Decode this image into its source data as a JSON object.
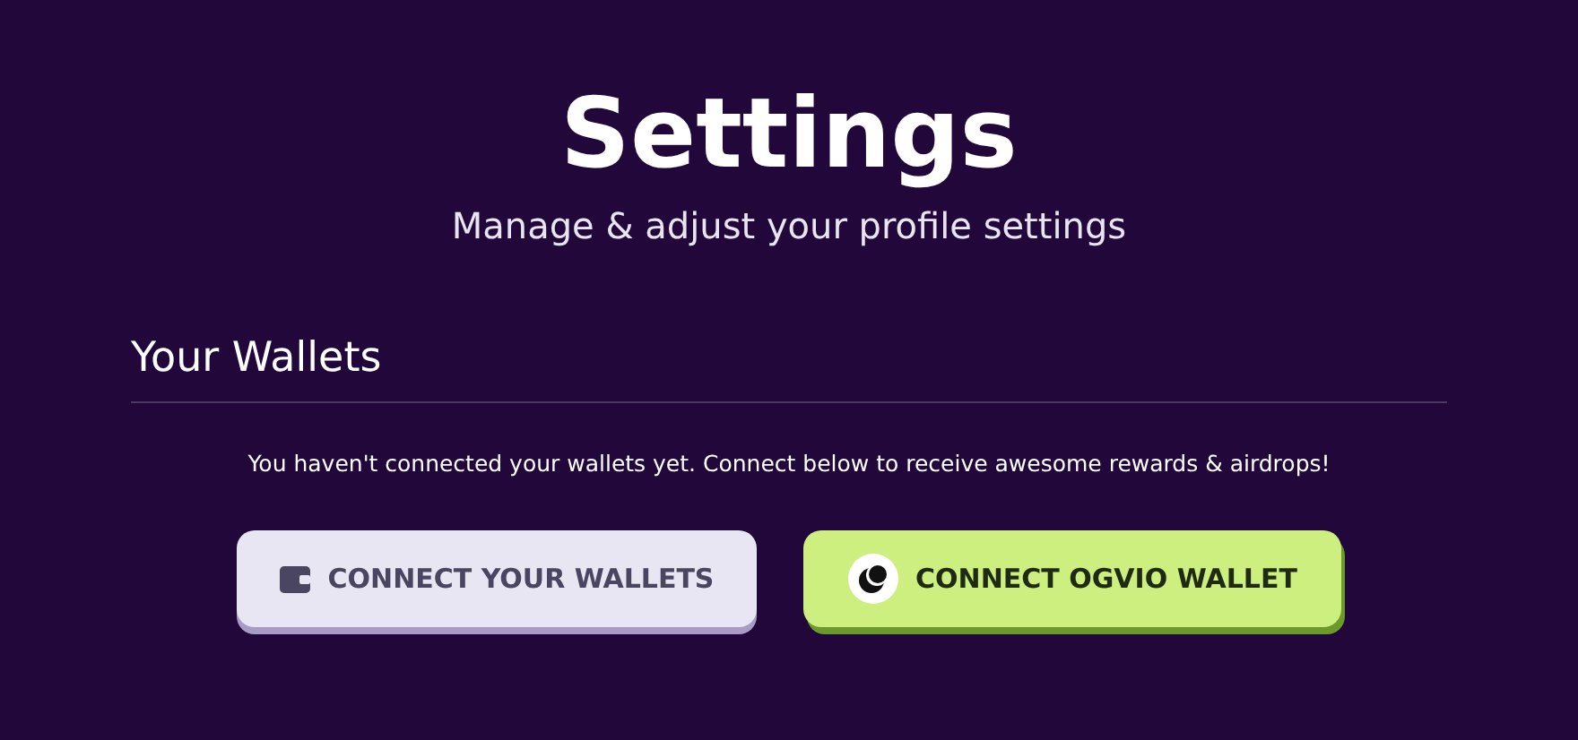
{
  "header": {
    "title": "Settings",
    "subtitle": "Manage & adjust your profile settings"
  },
  "section": {
    "title": "Your Wallets",
    "message": "You haven't connected your wallets yet. Connect below to receive awesome rewards & airdrops!"
  },
  "buttons": [
    {
      "label": "CONNECT YOUR WALLETS",
      "kind": "wallet"
    },
    {
      "label": "CONNECT OGVIO WALLET",
      "kind": "ogvio"
    }
  ]
}
